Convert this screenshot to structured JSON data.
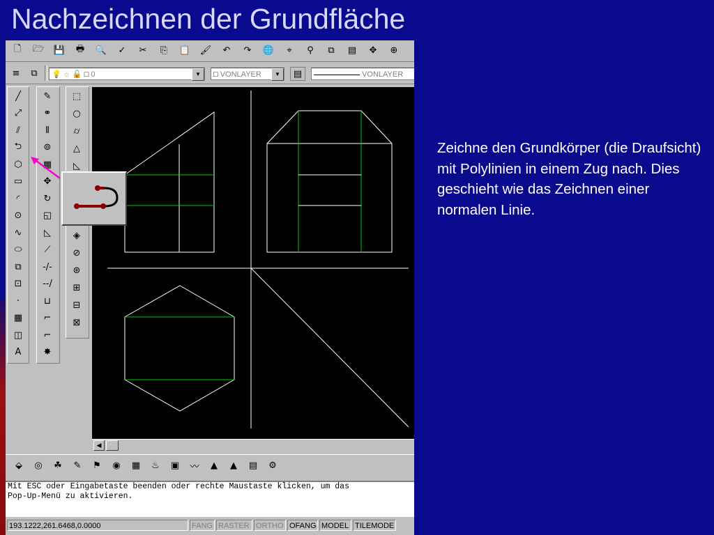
{
  "slide": {
    "title": "Nachzeichnen der Grundfläche",
    "description": "Zeichne den Grundkörper (die Draufsicht) mit Polylinien in einem Zug nach. Dies geschieht wie das Zeichnen einer normalen Linie."
  },
  "colors": {
    "background": "#0a0a8e",
    "canvas": "#000000",
    "geometry_white": "#ffffff",
    "geometry_green": "#00cc00",
    "pointer_arrow": "#ff00cc"
  },
  "toolbar_standard": {
    "icons": [
      "new-icon",
      "open-icon",
      "save-icon",
      "print-icon",
      "print-preview-icon",
      "spellcheck-icon",
      "cut-icon",
      "copy-icon",
      "paste-icon",
      "match-properties-icon",
      "undo-icon",
      "redo-icon",
      "hyperlink-icon",
      "tracking-icon",
      "snap-icon",
      "display-order-icon",
      "draw-order-icon",
      "pan-icon",
      "zoom-icon"
    ],
    "glyphs": [
      "🗋",
      "🗁",
      "💾",
      "🖶",
      "🔍",
      "✓",
      "✂",
      "⎘",
      "📋",
      "🖌",
      "↶",
      "↷",
      "🌐",
      "⌖",
      "⚲",
      "⧉",
      "▤",
      "✥",
      "⊕"
    ]
  },
  "toolbar_layers": {
    "layer_value": "0",
    "color_value": "VONLAYER",
    "linetype_value": "VONLAYER"
  },
  "draw_toolbar": {
    "icons": [
      "line-icon",
      "construction-line-icon",
      "multiline-icon",
      "polyline-icon",
      "polygon-icon",
      "rectangle-icon",
      "arc-icon",
      "circle-icon",
      "spline-icon",
      "ellipse-icon",
      "insert-block-icon",
      "make-block-icon",
      "point-icon",
      "hatch-icon",
      "region-icon",
      "text-icon"
    ],
    "glyphs": [
      "╱",
      "⤢",
      "⫽",
      "⮌",
      "⬡",
      "▭",
      "◜",
      "⊙",
      "∿",
      "⬭",
      "⧉",
      "⊡",
      "·",
      "▦",
      "◫",
      "A"
    ]
  },
  "modify_toolbar": {
    "icons": [
      "erase-icon",
      "copy-object-icon",
      "mirror-icon",
      "offset-icon",
      "array-icon",
      "move-icon",
      "rotate-icon",
      "scale-icon",
      "stretch-icon",
      "lengthen-icon",
      "trim-icon",
      "extend-icon",
      "break-icon",
      "chamfer-icon",
      "fillet-icon",
      "explode-icon"
    ],
    "glyphs": [
      "✎",
      "⚭",
      "⫴",
      "⊚",
      "▦",
      "✥",
      "↻",
      "◱",
      "◺",
      "⟋",
      "-/-",
      "--/",
      "⊔",
      "⌐",
      "⌐",
      "✸"
    ]
  },
  "solids_toolbar": {
    "icons": [
      "box-icon",
      "sphere-icon",
      "cylinder-icon",
      "cone-icon",
      "wedge-icon",
      "torus-icon",
      "extrude-icon",
      "revolve-icon",
      "slice-icon",
      "section-icon",
      "interfere-icon",
      "setup-view-icon",
      "setup-drawing-icon",
      "setup-profile-icon"
    ],
    "glyphs": [
      "⬚",
      "○",
      "⌭",
      "△",
      "◺",
      "◎",
      "⊡",
      "⟳",
      "◈",
      "⊘",
      "⊛",
      "⊞",
      "⊟",
      "⊠"
    ]
  },
  "bottom_toolbar": {
    "icons": [
      "shade-icon",
      "render-icon",
      "scenes-icon",
      "lights-icon",
      "materials-icon",
      "materials-library-icon",
      "mapping-icon",
      "background-icon",
      "fog-icon",
      "landscape-new-icon",
      "landscape-edit-icon",
      "landscape-library-icon",
      "render-preferences-icon",
      "statistics-icon"
    ],
    "glyphs": [
      "⬙",
      "◎",
      "☘",
      "✎",
      "⚑",
      "◉",
      "▦",
      "♨",
      "▣",
      "〰",
      "▲",
      "▲",
      "▤",
      "⚙"
    ]
  },
  "callout": {
    "name": "Polylinie"
  },
  "command_line": {
    "line1": "Mit ESC oder Eingabetaste beenden oder rechte Maustaste klicken, um das",
    "line2": "Pop-Up-Menü zu aktivieren."
  },
  "status_bar": {
    "coordinates": "193.1222,261.6468,0.0000",
    "fang": "FANG",
    "raster": "RASTER",
    "ortho": "ORTHO",
    "ofang": "OFANG",
    "model": "MODEL",
    "tilemode": "TILEMODE"
  }
}
